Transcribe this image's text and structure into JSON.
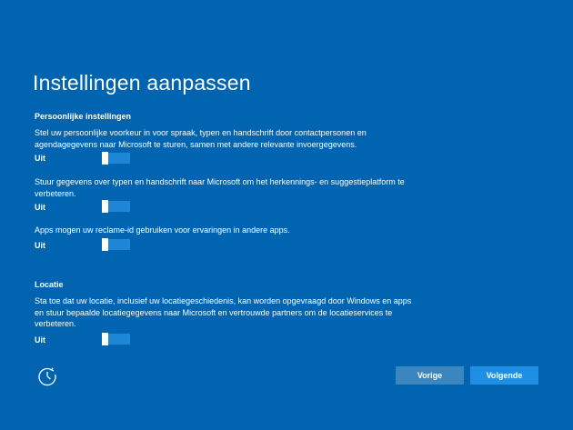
{
  "page": {
    "title": "Instellingen aanpassen"
  },
  "personal": {
    "heading": "Persoonlijke instellingen",
    "items": [
      {
        "description": "Stel uw persoonlijke voorkeur in voor spraak, typen en handschrift door contactpersonen en agendagegevens naar Microsoft te sturen, samen met andere relevante invoergegevens.",
        "state_label": "Uit",
        "enabled": false
      },
      {
        "description": "Stuur gegevens over typen en handschrift naar Microsoft om het herkennings- en suggestieplatform te verbeteren.",
        "state_label": "Uit",
        "enabled": false
      },
      {
        "description": "Apps mogen uw reclame-id gebruiken voor ervaringen in andere apps.",
        "state_label": "Uit",
        "enabled": false
      }
    ]
  },
  "location": {
    "heading": "Locatie",
    "items": [
      {
        "description": "Sta toe dat uw locatie, inclusief uw locatiegeschiedenis, kan worden opgevraagd door Windows en apps en stuur bepaalde locatiegegevens naar Microsoft en vertrouwde partners om de locatieservices te verbeteren.",
        "state_label": "Uit",
        "enabled": false
      }
    ]
  },
  "footer": {
    "help_icon": "ease-of-access-icon",
    "back_label": "Vorige",
    "next_label": "Volgende"
  },
  "colors": {
    "background": "#0064b0",
    "toggle_track": "#1e86d6",
    "back_button": "#3c86bf",
    "next_button": "#1f8fe3"
  }
}
